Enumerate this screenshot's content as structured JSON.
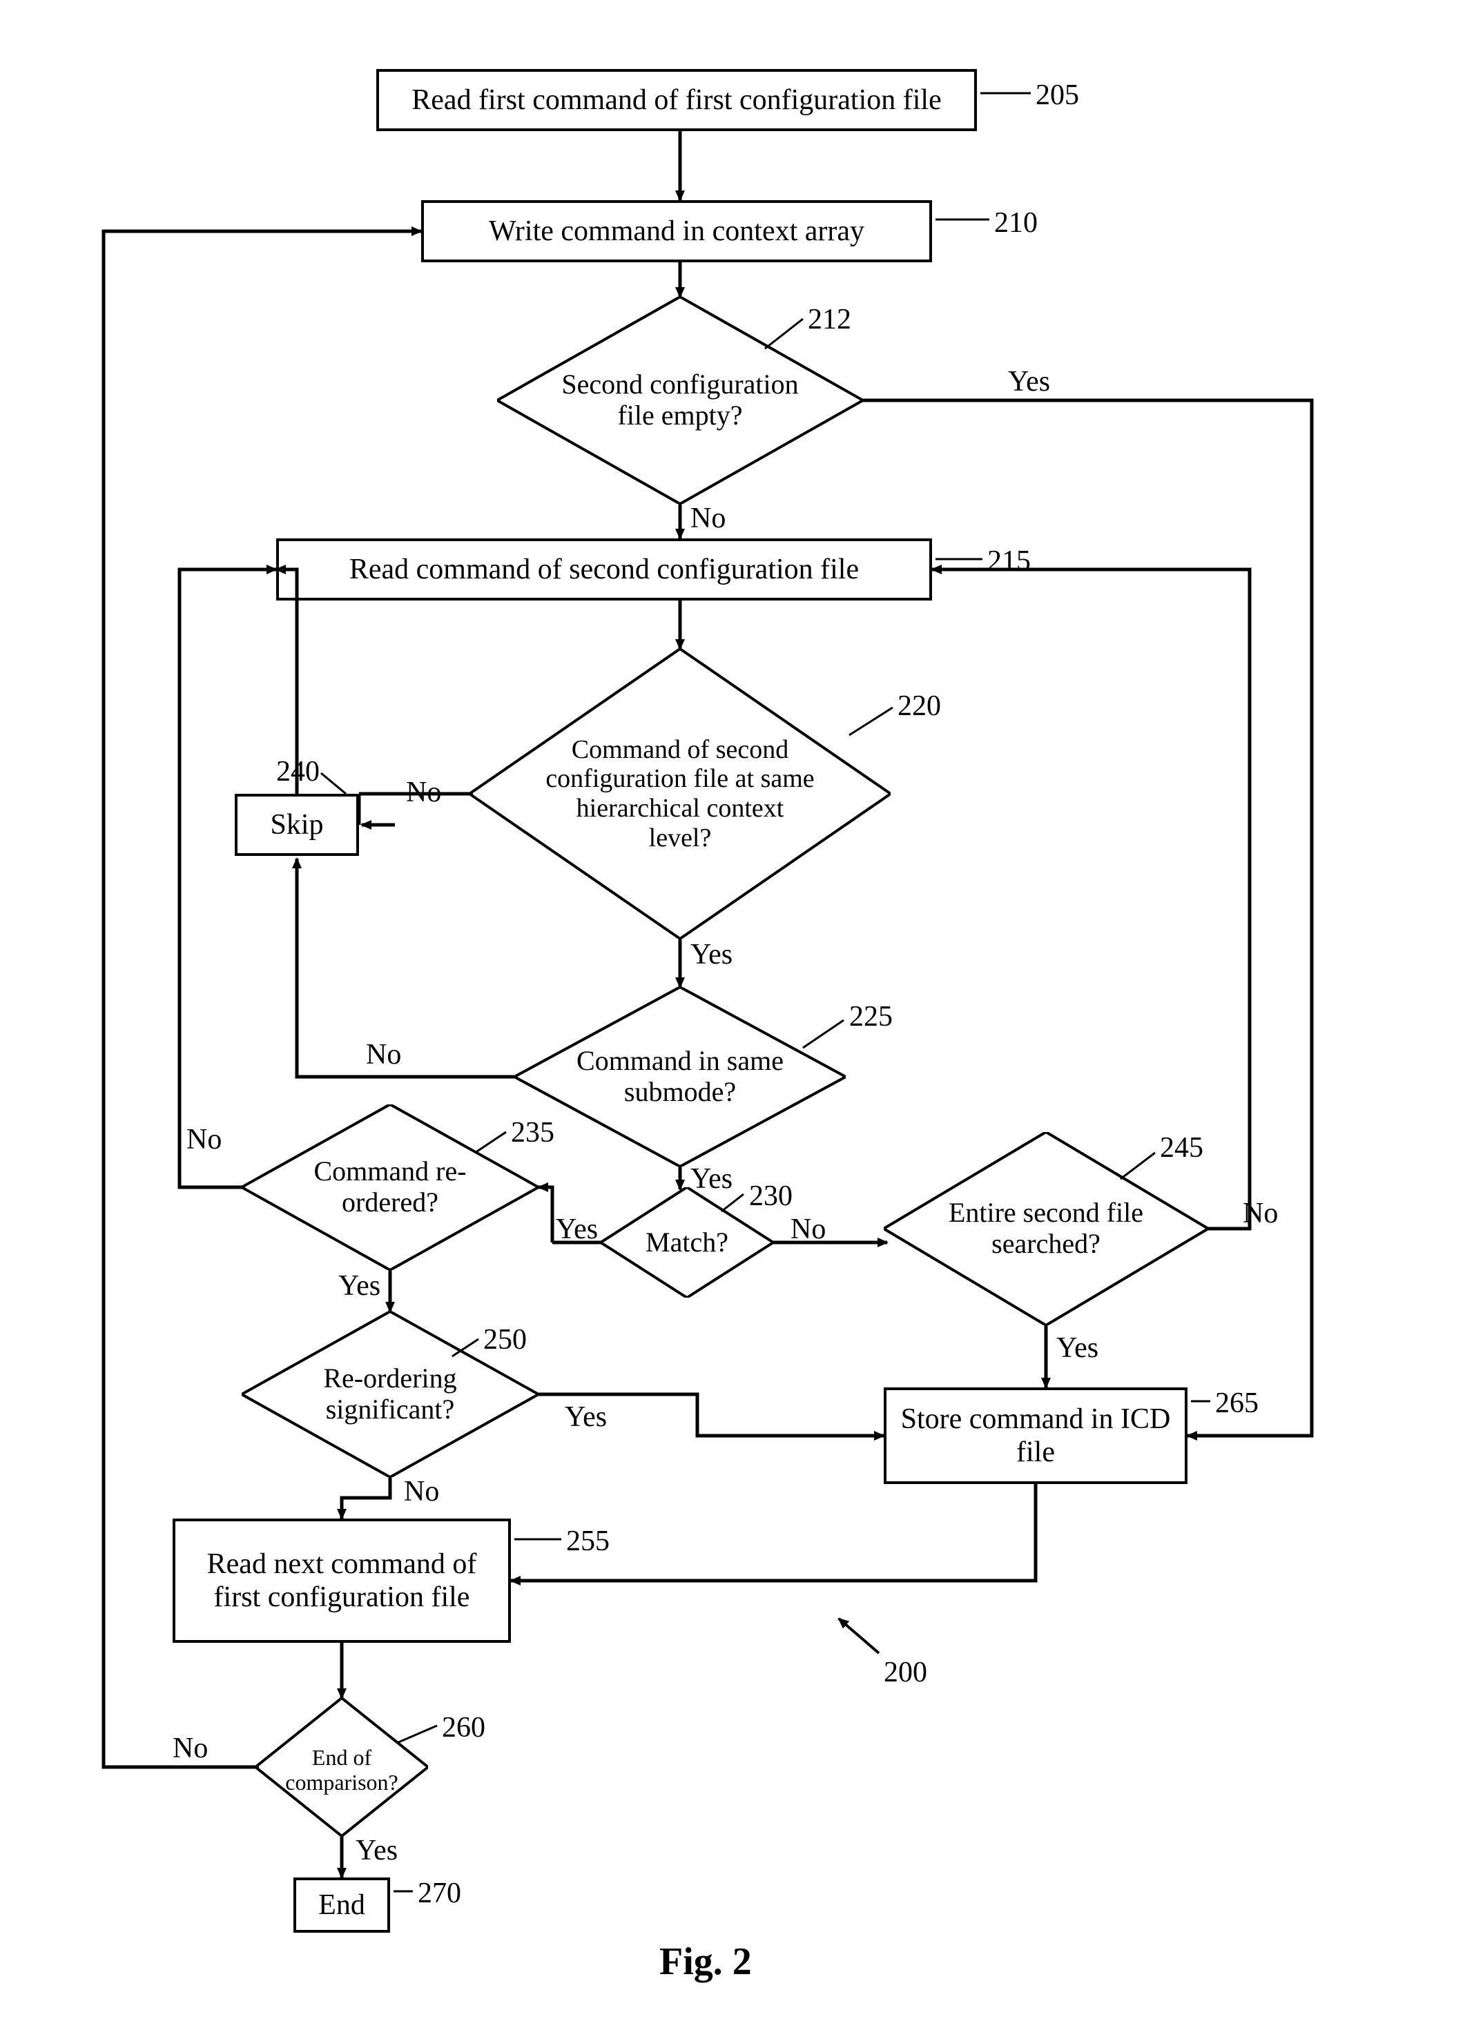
{
  "nodes": {
    "n205": "Read first command of first configuration file",
    "n210": "Write command in context array",
    "n212": "Second configuration file empty?",
    "n215": "Read command of second configuration file",
    "n220": "Command of second configuration file at same hierarchical context level?",
    "n225": "Command in same submode?",
    "n230": "Match?",
    "n235": "Command re-ordered?",
    "n240": "Skip",
    "n245": "Entire second file searched?",
    "n250": "Re-ordering significant?",
    "n255": "Read next command of first configuration file",
    "n260": "End of comparison?",
    "n265": "Store command in ICD file",
    "n270": "End"
  },
  "refs": {
    "r205": "205",
    "r210": "210",
    "r212": "212",
    "r215": "215",
    "r220": "220",
    "r225": "225",
    "r230": "230",
    "r235": "235",
    "r240": "240",
    "r245": "245",
    "r250": "250",
    "r255": "255",
    "r260": "260",
    "r265": "265",
    "r270": "270",
    "r200": "200"
  },
  "edges": {
    "yes": "Yes",
    "no": "No"
  },
  "figure": "Fig. 2"
}
